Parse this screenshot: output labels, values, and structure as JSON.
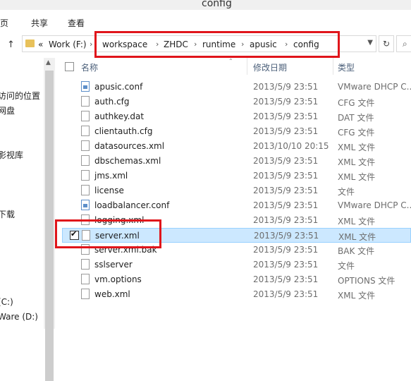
{
  "window": {
    "title": "config"
  },
  "ribbon": {
    "tabs": [
      "页",
      "共享",
      "查看"
    ]
  },
  "address": {
    "prefix": "«",
    "root": "Work (F:)",
    "segments": [
      "workspace",
      "ZHDC",
      "runtime",
      "apusic",
      "config"
    ]
  },
  "nav_pane": {
    "items": [
      "访问的位置",
      "网盘",
      "影视库",
      "下载",
      "(C:)",
      "Ware (D:)"
    ]
  },
  "columns": {
    "name": "名称",
    "date": "修改日期",
    "type": "类型"
  },
  "files": [
    {
      "name": "apusic.conf",
      "date": "2013/5/9 23:51",
      "type": "VMware DHCP C...",
      "icon": "conf-file-icon"
    },
    {
      "name": "auth.cfg",
      "date": "2013/5/9 23:51",
      "type": "CFG 文件",
      "icon": "file-icon"
    },
    {
      "name": "authkey.dat",
      "date": "2013/5/9 23:51",
      "type": "DAT 文件",
      "icon": "file-icon"
    },
    {
      "name": "clientauth.cfg",
      "date": "2013/5/9 23:51",
      "type": "CFG 文件",
      "icon": "file-icon"
    },
    {
      "name": "datasources.xml",
      "date": "2013/10/10 20:15",
      "type": "XML 文件",
      "icon": "file-icon"
    },
    {
      "name": "dbschemas.xml",
      "date": "2013/5/9 23:51",
      "type": "XML 文件",
      "icon": "file-icon"
    },
    {
      "name": "jms.xml",
      "date": "2013/5/9 23:51",
      "type": "XML 文件",
      "icon": "file-icon"
    },
    {
      "name": "license",
      "date": "2013/5/9 23:51",
      "type": "文件",
      "icon": "file-icon"
    },
    {
      "name": "loadbalancer.conf",
      "date": "2013/5/9 23:51",
      "type": "VMware DHCP C...",
      "icon": "conf-file-icon"
    },
    {
      "name": "logging.xml",
      "date": "2013/5/9 23:51",
      "type": "XML 文件",
      "icon": "file-icon"
    },
    {
      "name": "server.xml",
      "date": "2013/5/9 23:51",
      "type": "XML 文件",
      "icon": "file-icon",
      "selected": true
    },
    {
      "name": "server.xml.bak",
      "date": "2013/5/9 23:51",
      "type": "BAK 文件",
      "icon": "file-icon"
    },
    {
      "name": "sslserver",
      "date": "2013/5/9 23:51",
      "type": "文件",
      "icon": "file-icon"
    },
    {
      "name": "vm.options",
      "date": "2013/5/9 23:51",
      "type": "OPTIONS 文件",
      "icon": "file-icon"
    },
    {
      "name": "web.xml",
      "date": "2013/5/9 23:51",
      "type": "XML 文件",
      "icon": "file-icon"
    }
  ],
  "colors": {
    "highlight": "#e0151b",
    "selection": "#cce8ff"
  }
}
